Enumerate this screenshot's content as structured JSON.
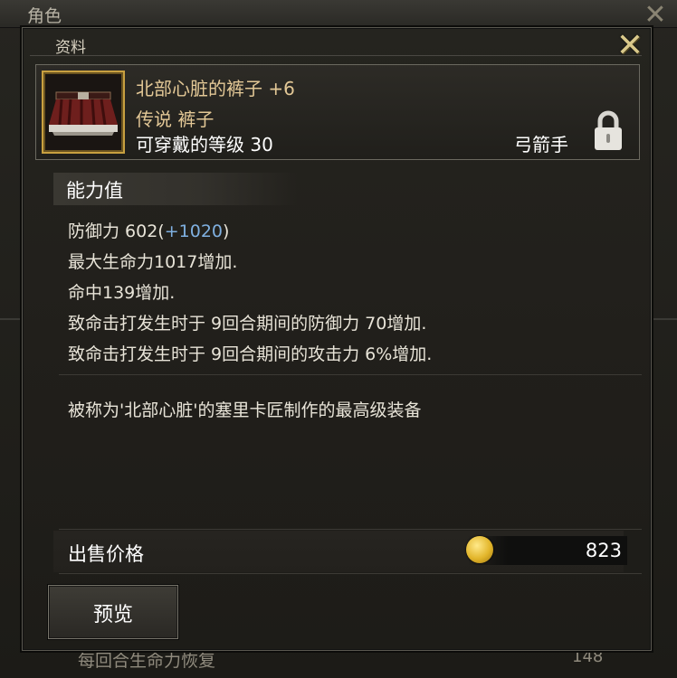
{
  "background_window": {
    "title": "角色",
    "bottom_text": "每回合生命力恢复",
    "bottom_value": "148"
  },
  "dialog": {
    "title": "资料"
  },
  "item": {
    "name": "北部心脏的裤子 +6",
    "grade_type": "传说 裤子",
    "level_requirement": "可穿戴的等级 30",
    "class": "弓箭手",
    "icon": "red-skirt-pants-icon",
    "locked": true
  },
  "stats": {
    "header": "能力值",
    "defense_label": "防御力 602(",
    "defense_bonus": "+1020",
    "defense_close": ")",
    "lines": [
      "最大生命力1017增加.",
      "命中139增加.",
      "致命击打发生时于 9回合期间的防御力 70增加.",
      "致命击打发生时于 9回合期间的攻击力 6%增加."
    ]
  },
  "description": "被称为'北部心脏'的塞里卡匠制作的最高级装备",
  "price": {
    "label": "出售价格",
    "value": "823",
    "currency_icon": "gold-coin-icon"
  },
  "buttons": {
    "preview": "预览"
  },
  "colors": {
    "item_name": "#e3c896",
    "bonus": "#7fb0e0",
    "frame_gold": "#c8a040"
  }
}
